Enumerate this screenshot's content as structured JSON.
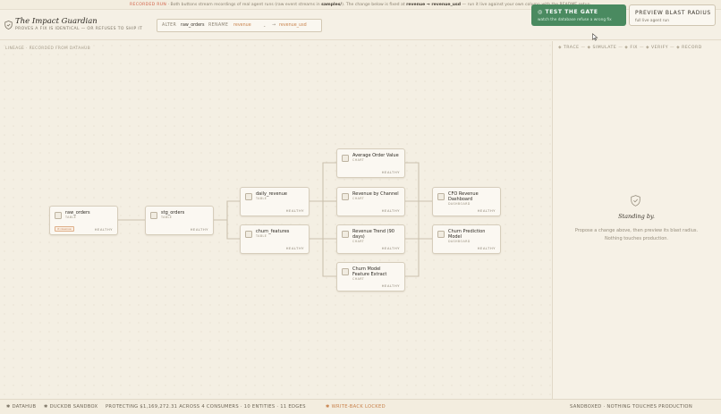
{
  "banner": {
    "tag": "RECORDED RUN",
    "lead": "· Both buttons stream recordings of real agent runs (raw event streams in",
    "file": "samples/",
    "mid": "). The change below is fixed at",
    "change": "revenue → revenue_usd",
    "tail": "— run it live against your own column with the README setup."
  },
  "app": {
    "title": "The Impact Guardian",
    "subtitle": "PROVES A FIX IS IDENTICAL — OR REFUSES TO SHIP IT"
  },
  "command": {
    "alter_kw": "ALTER",
    "table": "raw_orders",
    "rename_kw": "RENAME",
    "from_column": "revenue",
    "chevron": "⌄",
    "arrow": "→",
    "to_column": "revenue_usd"
  },
  "actions": {
    "gate": {
      "label": "TEST THE GATE",
      "sub": "watch the database refuse a wrong fix"
    },
    "blast": {
      "label": "PREVIEW BLAST RADIUS",
      "sub": "full live agent run"
    }
  },
  "lineage": {
    "label": "LINEAGE · RECORDED FROM DATAHUB",
    "nodes": [
      {
        "id": "raw_orders",
        "name": "raw_orders",
        "type": "TABLE",
        "status": "HEALTHY",
        "badge": "⊘ revenue"
      },
      {
        "id": "stg_orders",
        "name": "stg_orders",
        "type": "TABLE",
        "status": "HEALTHY"
      },
      {
        "id": "daily_revenue",
        "name": "daily_revenue",
        "type": "TABLE",
        "status": "HEALTHY"
      },
      {
        "id": "churn_features",
        "name": "churn_features",
        "type": "TABLE",
        "status": "HEALTHY"
      },
      {
        "id": "aov",
        "name": "Average Order Value",
        "type": "CHART",
        "status": "HEALTHY"
      },
      {
        "id": "rbc",
        "name": "Revenue by Channel",
        "type": "CHART",
        "status": "HEALTHY"
      },
      {
        "id": "rt90",
        "name": "Revenue Trend (90 days)",
        "type": "CHART",
        "status": "HEALTHY"
      },
      {
        "id": "cmfe",
        "name": "Churn Model Feature Extract",
        "type": "CHART",
        "status": "HEALTHY"
      },
      {
        "id": "cfo",
        "name": "CFO Revenue Dashboard",
        "type": "DASHBOARD",
        "status": "HEALTHY"
      },
      {
        "id": "cpm",
        "name": "Churn Prediction Model",
        "type": "DASHBOARD",
        "status": "HEALTHY"
      }
    ]
  },
  "panel": {
    "steps": [
      "TRACE",
      "SIMULATE",
      "FIX",
      "VERIFY",
      "RECORD"
    ],
    "title": "Standing by.",
    "desc_line1": "Propose a change above, then preview its blast radius.",
    "desc_line2": "Nothing touches production."
  },
  "footer": {
    "datahub": "DATAHUB",
    "duckdb": "DUCKDB SANDBOX",
    "protecting": "PROTECTING $1,169,272.31 ACROSS 4 CONSUMERS · 10 ENTITIES · 11 EDGES",
    "writeback": "WRITE-BACK LOCKED",
    "sandboxed": "SANDBOXED · NOTHING TOUCHES PRODUCTION"
  },
  "colors": {
    "accent_green": "#4a8a60",
    "accent_orange": "#c8824c",
    "recorded_red": "#d2644a",
    "background": "#f4efe3"
  }
}
